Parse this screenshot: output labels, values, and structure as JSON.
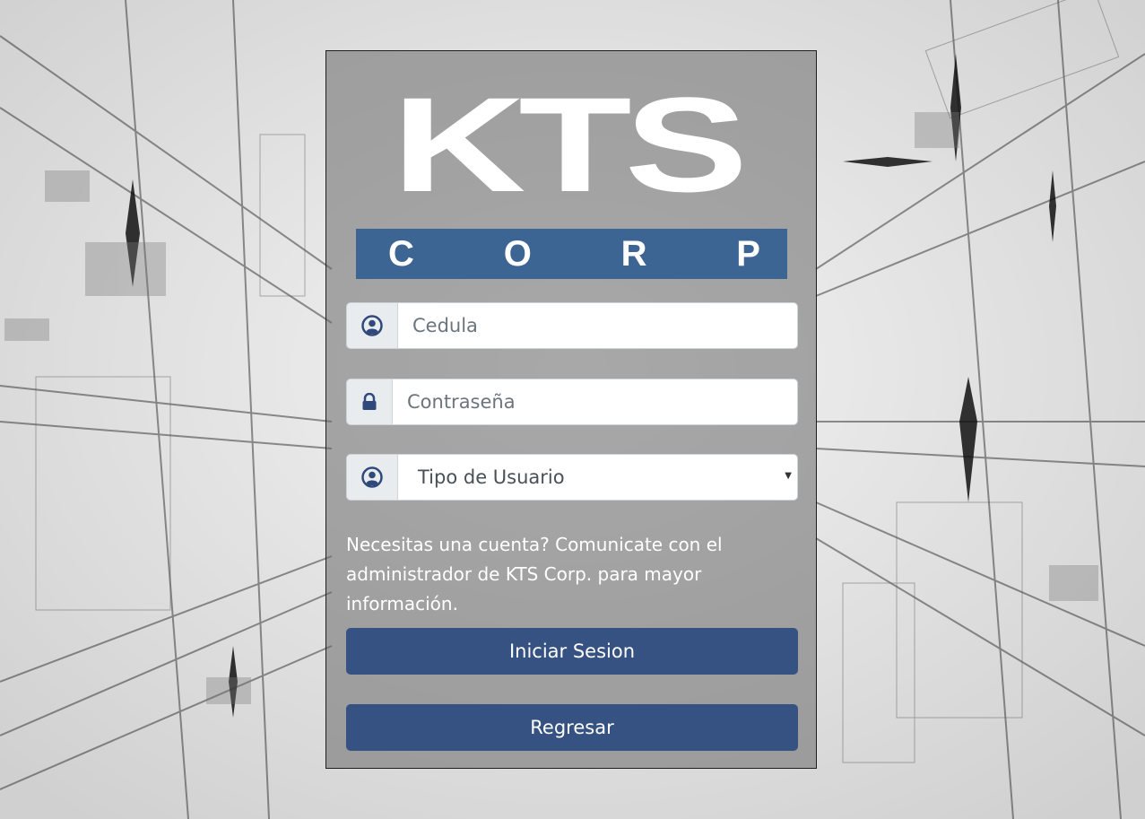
{
  "logo": {
    "main_text": "KTS",
    "sub_letters": [
      "C",
      "O",
      "R",
      "P"
    ]
  },
  "form": {
    "cedula": {
      "placeholder": "Cedula",
      "icon": "user-circle-icon"
    },
    "password": {
      "placeholder": "Contraseña",
      "icon": "lock-icon"
    },
    "user_type": {
      "selected": "Tipo de Usuario",
      "icon": "user-circle-icon"
    }
  },
  "info_text": "Necesitas una cuenta? Comunicate con el administrador de KTS Corp. para mayor información.",
  "buttons": {
    "login": "Iniciar Sesion",
    "back": "Regresar"
  },
  "colors": {
    "brand_blue": "#3d6593",
    "button_blue": "#355282",
    "icon_blue": "#2f4a7a"
  }
}
